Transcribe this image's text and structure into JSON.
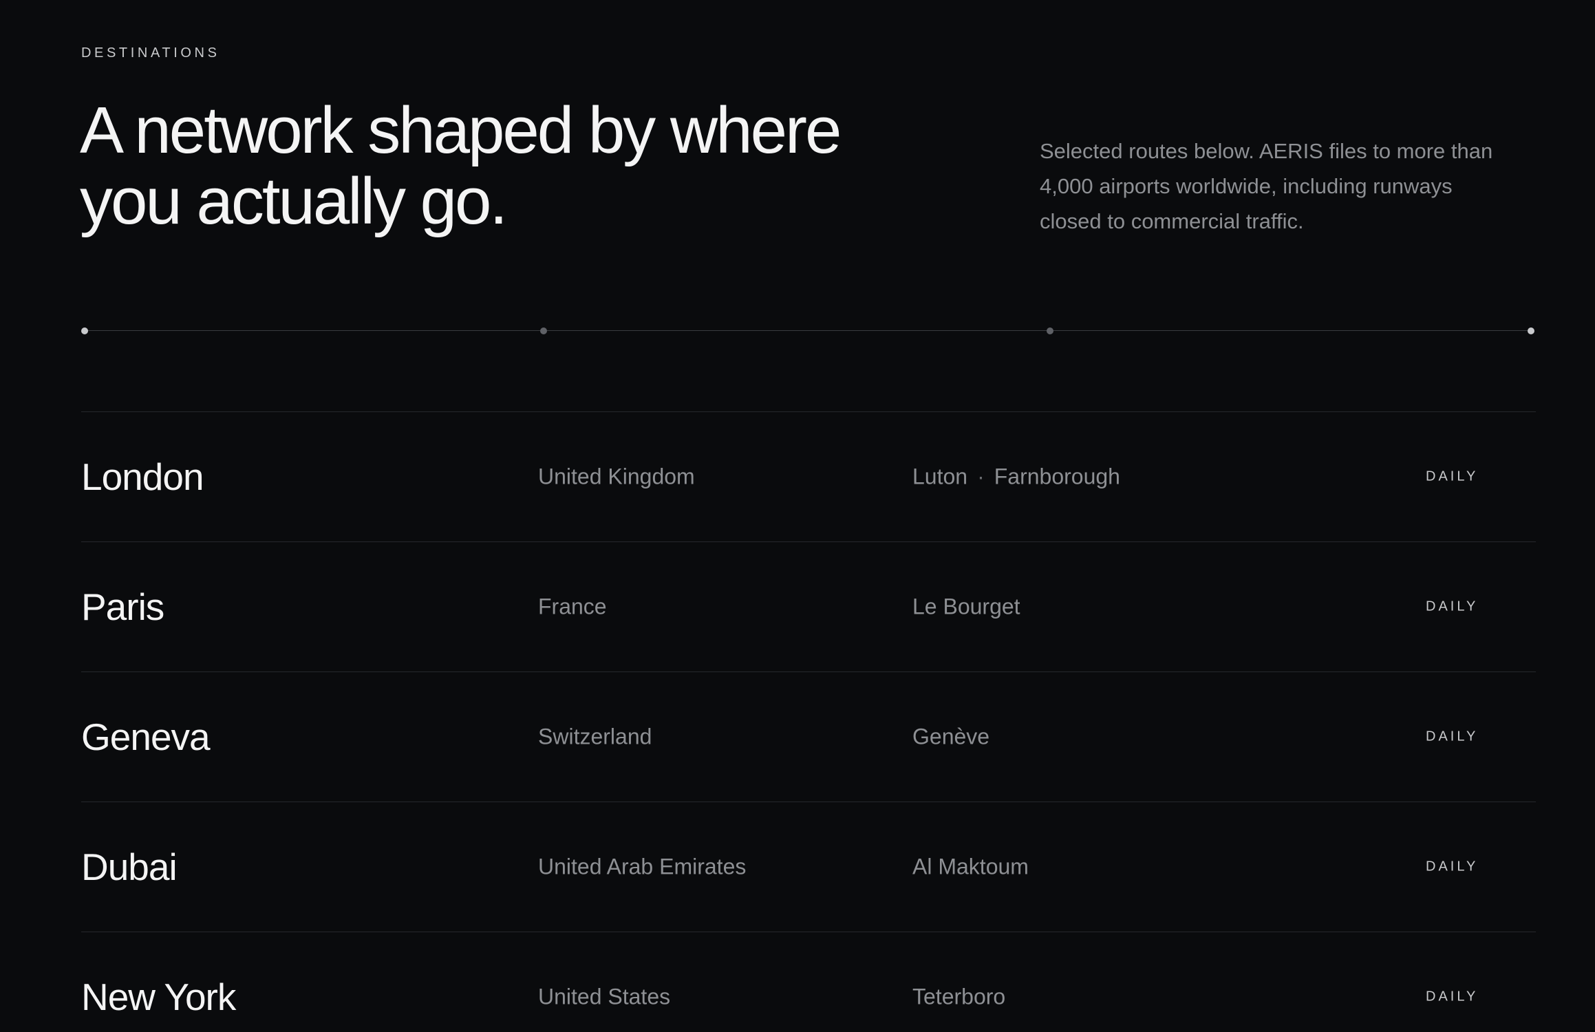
{
  "section": {
    "eyebrow": "DESTINATIONS",
    "headline_line1": "A network shaped by where",
    "headline_line2": "you actually go.",
    "intro": "Selected routes below. AERIS files to more than 4,000 airports worldwide, including runways closed to commercial traffic."
  },
  "destinations": [
    {
      "city": "London",
      "country": "United Kingdom",
      "airports": [
        "Luton",
        "Farnborough"
      ],
      "frequency": "DAILY"
    },
    {
      "city": "Paris",
      "country": "France",
      "airports": [
        "Le Bourget"
      ],
      "frequency": "DAILY"
    },
    {
      "city": "Geneva",
      "country": "Switzerland",
      "airports": [
        "Genève"
      ],
      "frequency": "DAILY"
    },
    {
      "city": "Dubai",
      "country": "United Arab Emirates",
      "airports": [
        "Al Maktoum"
      ],
      "frequency": "DAILY"
    },
    {
      "city": "New York",
      "country": "United States",
      "airports": [
        "Teterboro"
      ],
      "frequency": "DAILY"
    }
  ],
  "colors": {
    "background": "#0a0b0d",
    "text_primary": "#f4f4f4",
    "text_muted": "#8e9094",
    "divider": "#26282c"
  },
  "airport_separator": "·"
}
